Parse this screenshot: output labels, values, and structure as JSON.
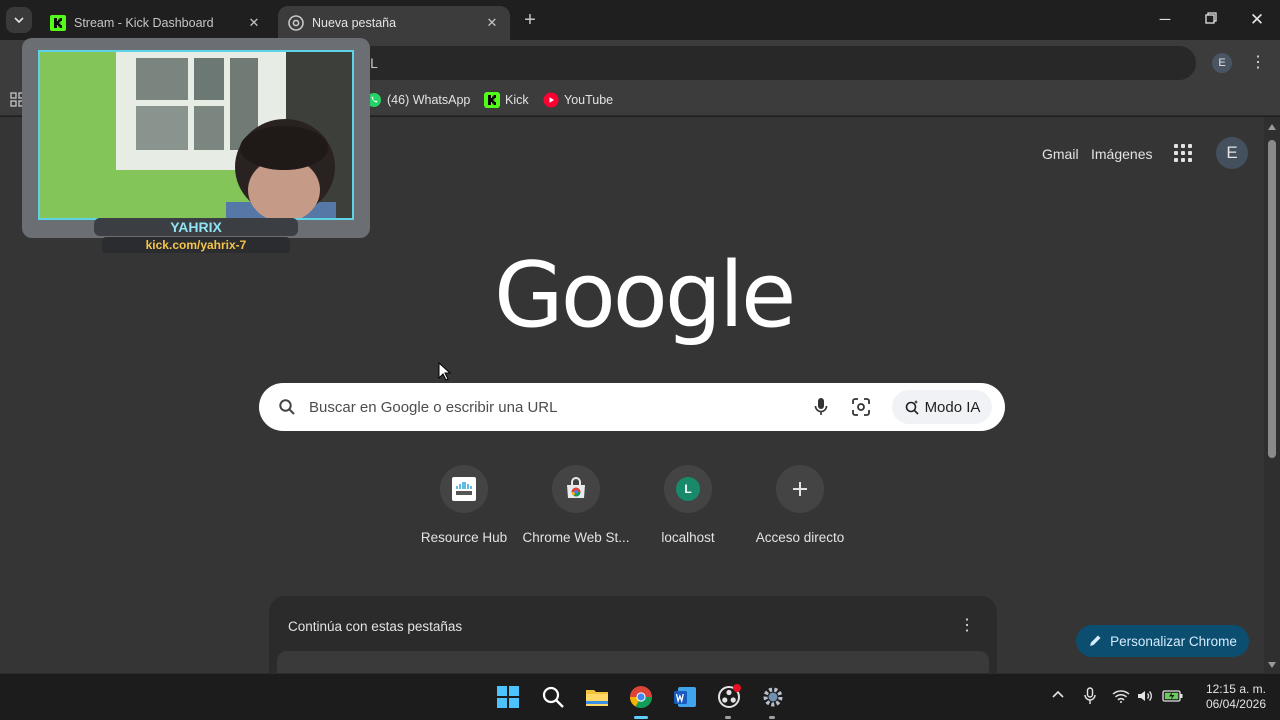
{
  "tabs": [
    {
      "title": "Stream - Kick Dashboard",
      "active": false
    },
    {
      "title": "Nueva pestaña",
      "active": true
    }
  ],
  "omnibox": {
    "text": "RL"
  },
  "profile_initial": "E",
  "bookmarks": [
    {
      "label": "(46) WhatsApp",
      "icon": "whatsapp-icon"
    },
    {
      "label": "Kick",
      "icon": "kick-icon"
    },
    {
      "label": "YouTube",
      "icon": "youtube-icon"
    }
  ],
  "header_links": {
    "gmail": "Gmail",
    "images": "Imágenes"
  },
  "logo": "Google",
  "search": {
    "placeholder": "Buscar en Google o escribir una URL",
    "ai_mode": "Modo IA"
  },
  "shortcuts": [
    {
      "label": "Resource Hub",
      "icon": "cisco-icon"
    },
    {
      "label": "Chrome Web St...",
      "icon": "chrome-web-store-icon"
    },
    {
      "label": "localhost",
      "icon_letter": "L"
    },
    {
      "label": "Acceso directo",
      "icon": "plus-icon"
    }
  ],
  "continue_card": {
    "title": "Continúa con estas pestañas"
  },
  "customize_button": "Personalizar Chrome",
  "webcam": {
    "name": "YAHRIX",
    "url": "kick.com/yahrix-7"
  },
  "clock": {
    "time": "12:15 a. m.",
    "date": "06/04/2026"
  },
  "colors": {
    "accent": "#0b4e6f",
    "kick_green": "#53fc18",
    "page_bg": "#353535"
  }
}
